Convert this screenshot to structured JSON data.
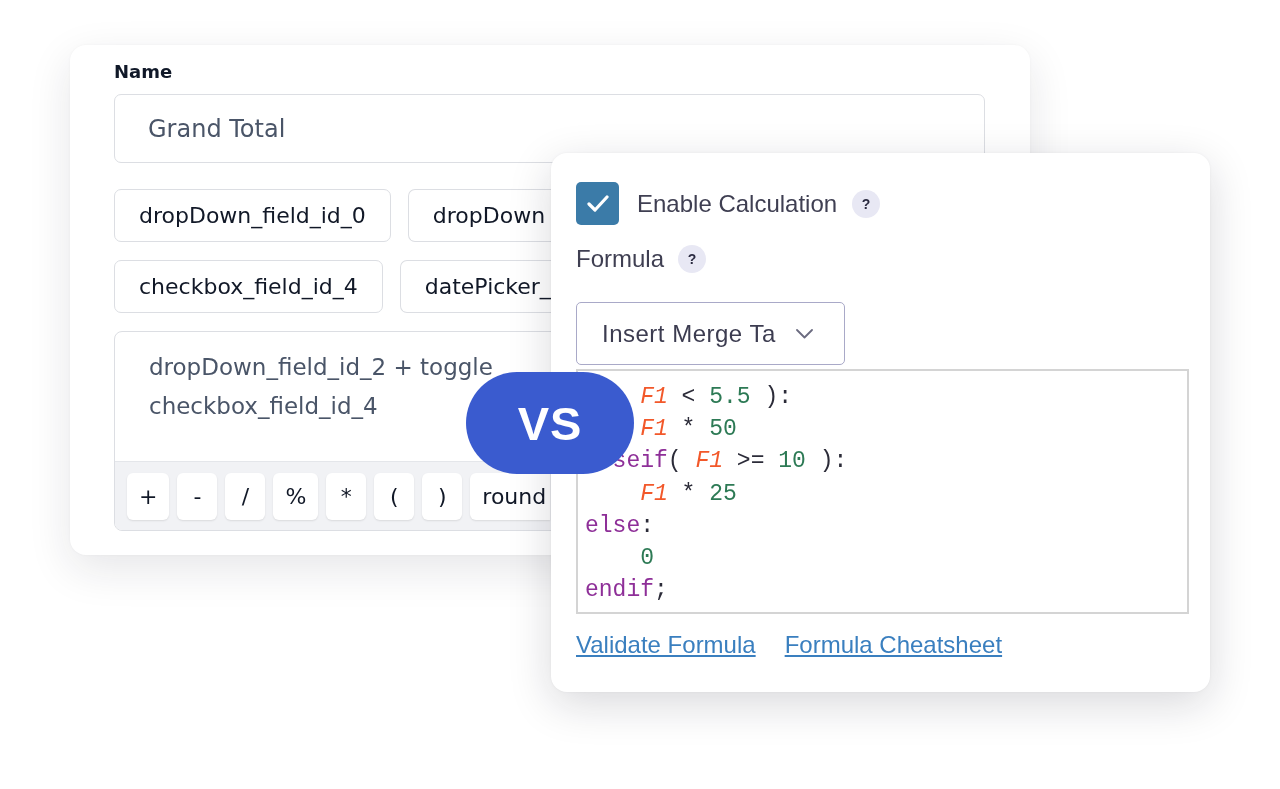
{
  "name_card": {
    "name_field": {
      "label": "Name",
      "value": "Grand Total"
    },
    "field_tag_rows": [
      {
        "tags": [
          "dropDown_field_id_0",
          "dropDown"
        ]
      },
      {
        "tags": [
          "checkbox_field_id_4",
          "datePicker_"
        ]
      }
    ],
    "expression": {
      "lines": [
        "dropDown_field_id_2 + toggle",
        "checkbox_field_id_4"
      ]
    },
    "operator_buttons": [
      "+",
      "-",
      "/",
      "%",
      "*",
      "(",
      ")",
      "round"
    ]
  },
  "vs_badge": "VS",
  "calculation_card": {
    "enable_calculation": {
      "label": "Enable Calculation",
      "checked": true,
      "help": "?"
    },
    "formula": {
      "label": "Formula",
      "help": "?"
    },
    "merge_tag_select": {
      "value": "Insert Merge Ta"
    },
    "code_lines": [
      {
        "kind": "indented",
        "tokens": [
          {
            "kind": "variable",
            "text": "F1"
          },
          {
            "kind": "operator",
            "text": " < "
          },
          {
            "kind": "number",
            "text": "5.5"
          },
          {
            "kind": "operator",
            "text": " ):"
          }
        ]
      },
      {
        "kind": "indented",
        "tokens": [
          {
            "kind": "variable",
            "text": "F1"
          },
          {
            "kind": "operator",
            "text": " * "
          },
          {
            "kind": "number",
            "text": "50"
          }
        ]
      },
      {
        "kind": "clipped",
        "tokens": [
          {
            "kind": "keyword",
            "text": "seif"
          },
          {
            "kind": "operator",
            "text": "( "
          },
          {
            "kind": "variable",
            "text": "F1"
          },
          {
            "kind": "operator",
            "text": " >= "
          },
          {
            "kind": "number",
            "text": "10"
          },
          {
            "kind": "operator",
            "text": " ):"
          }
        ]
      },
      {
        "kind": "indented",
        "tokens": [
          {
            "kind": "variable",
            "text": "F1"
          },
          {
            "kind": "operator",
            "text": " * "
          },
          {
            "kind": "number",
            "text": "25"
          }
        ]
      },
      {
        "kind": "flush",
        "tokens": [
          {
            "kind": "keyword",
            "text": "else"
          },
          {
            "kind": "operator",
            "text": ":"
          }
        ]
      },
      {
        "kind": "indented",
        "tokens": [
          {
            "kind": "number",
            "text": "0"
          }
        ]
      },
      {
        "kind": "flush",
        "tokens": [
          {
            "kind": "keyword",
            "text": "endif"
          },
          {
            "kind": "operator",
            "text": ";"
          }
        ]
      }
    ],
    "links": [
      "Validate Formula",
      "Formula Cheatsheet"
    ]
  }
}
